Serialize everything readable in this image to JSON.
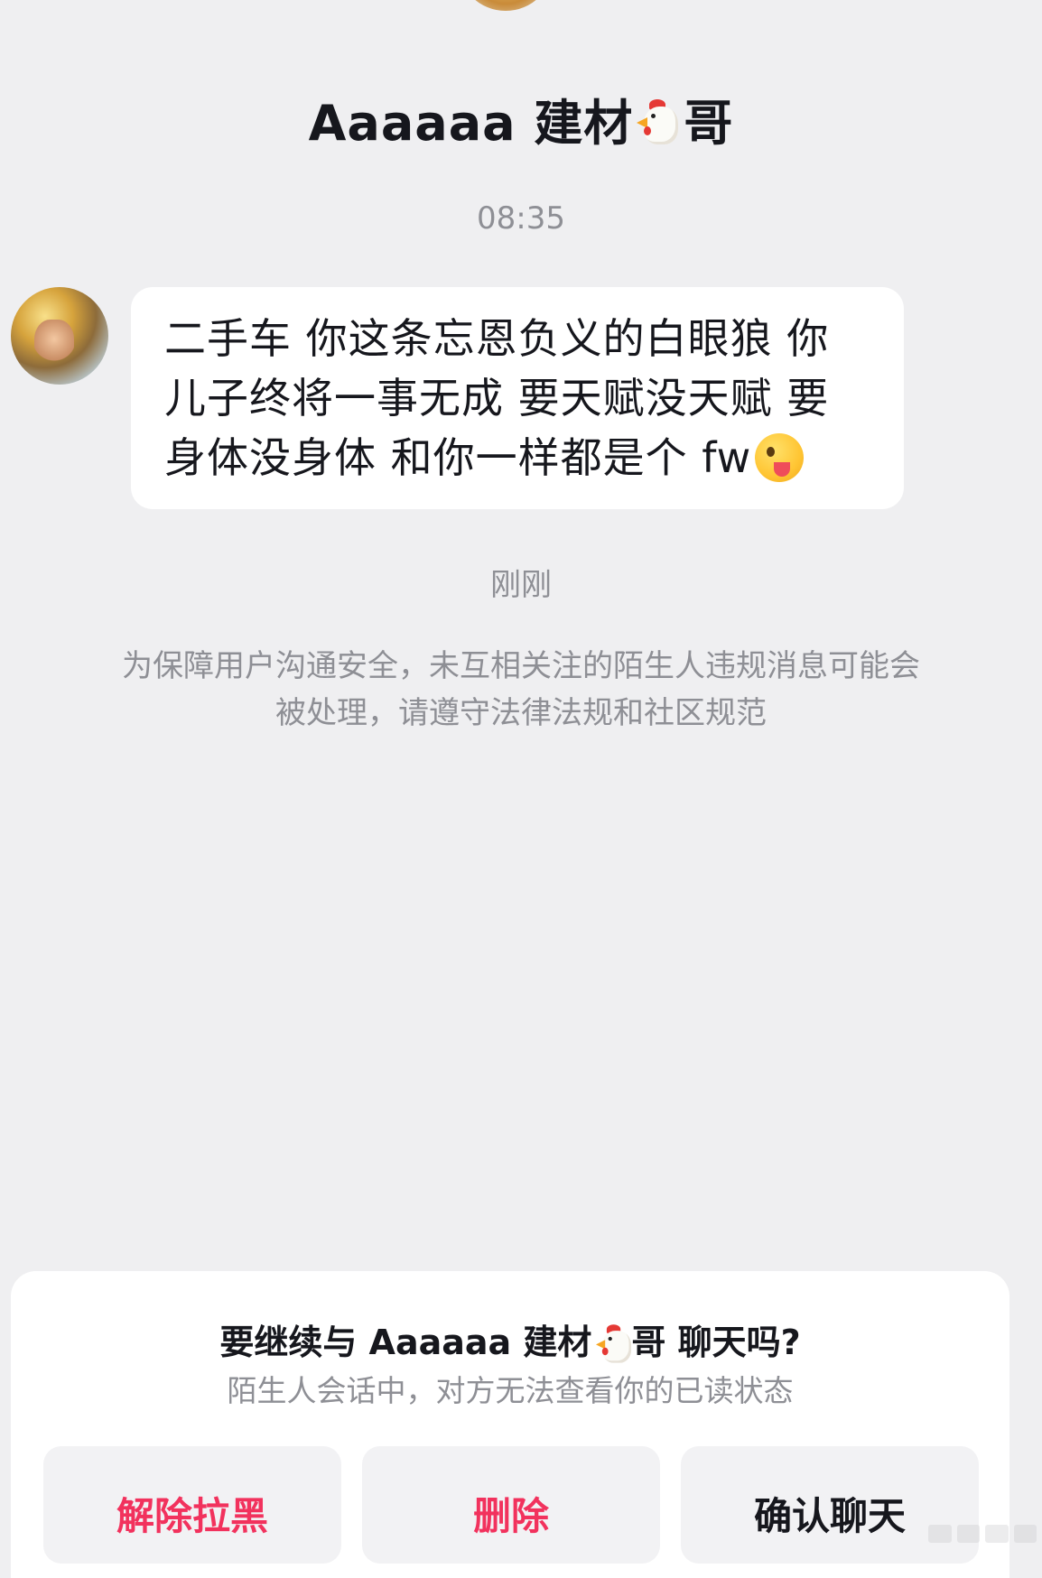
{
  "header": {
    "title_prefix": "Aaaaaa 建材",
    "title_suffix": "哥",
    "title_emoji": "chicken-emoji"
  },
  "conversation": {
    "timestamp": "08:35",
    "message": {
      "text": "二手车 你这条忘恩负义的白眼狼 你儿子终将一事无成 要天赋没天赋 要身体没身体 和你一样都是个 fw",
      "trailing_emoji": "winking-tongue-emoji"
    },
    "recent_label": "刚刚",
    "safety_notice": "为保障用户沟通安全，未互相关注的陌生人违规消息可能会被处理，请遵守法律法规和社区规范"
  },
  "bottom_sheet": {
    "question_prefix": "要继续与 Aaaaaa 建材",
    "question_suffix": "哥 聊天吗?",
    "subtitle": "陌生人会话中，对方无法查看你的已读状态",
    "buttons": {
      "unblock": "解除拉黑",
      "delete": "删除",
      "confirm": "确认聊天"
    }
  },
  "colors": {
    "background": "#efeff1",
    "bubble": "#ffffff",
    "accent_red": "#f2325d",
    "muted_text": "#8e8f95"
  }
}
